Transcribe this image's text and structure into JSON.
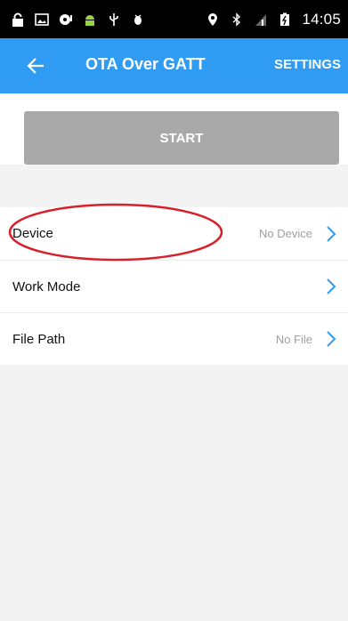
{
  "status_bar": {
    "time": "14:05",
    "icons_left": [
      "lock-icon",
      "image-icon",
      "chat-icon",
      "android-icon",
      "usb-icon",
      "debug-icon"
    ],
    "icons_right": [
      "location-icon",
      "bluetooth-icon",
      "signal-icon",
      "battery-icon"
    ]
  },
  "app_bar": {
    "title": "OTA Over GATT",
    "settings_label": "SETTINGS",
    "color": "#2f9bf2"
  },
  "start": {
    "label": "START",
    "color": "#a9a9a9"
  },
  "list": {
    "rows": [
      {
        "label": "Device",
        "value": "No Device"
      },
      {
        "label": "Work Mode",
        "value": ""
      },
      {
        "label": "File Path",
        "value": "No File"
      }
    ]
  },
  "annotation": {
    "color": "#d9202a"
  }
}
